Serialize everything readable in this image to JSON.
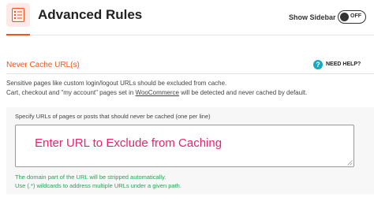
{
  "header": {
    "title": "Advanced Rules",
    "show_sidebar_label": "Show Sidebar",
    "toggle_state": "OFF"
  },
  "section": {
    "title": "Never Cache URL(s)",
    "help_label": "NEED HELP?",
    "description_line1": "Sensitive pages like custom login/logout URLs should be excluded from cache.",
    "description_line2_pre": "Cart, checkout and \"my account\" pages set in ",
    "description_line2_link": "WooCommerce",
    "description_line2_post": " will be detected and never cached by default."
  },
  "field": {
    "label": "Specify URLs of pages or posts that should never be cached (one per line)",
    "value": "Enter URL to Exclude from Caching",
    "hint_line1": "The domain part of the URL will be stripped automatically.",
    "hint_line2": "Use (.*) wildcards to address multiple URLs under a given path."
  },
  "colors": {
    "accent": "#f1541d",
    "help": "#15a9c4",
    "input_text": "#e6236f",
    "hint": "#25a35a"
  },
  "icons": [
    "settings-list-icon",
    "help-icon",
    "resize-handle-icon"
  ]
}
